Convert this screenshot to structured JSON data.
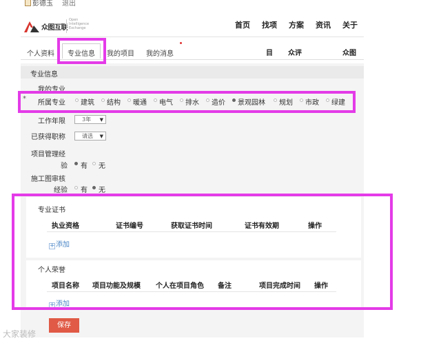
{
  "topbar": {
    "username": "彭德玉",
    "logout": "退出"
  },
  "header": {
    "logo_text": "众图互联",
    "logo_sub": "Open Intelligence Exchange",
    "nav": [
      "首页",
      "找项",
      "方案",
      "资讯",
      "关于"
    ]
  },
  "tabs": [
    {
      "label": "个人资料",
      "active": false
    },
    {
      "label": "专业信息",
      "active": true
    },
    {
      "label": "我的项目",
      "active": false
    },
    {
      "label": "我的消息",
      "active": false
    }
  ],
  "right_links": [
    "目",
    "众评",
    "众图"
  ],
  "form": {
    "title": "专业信息",
    "my_specialty_label": "我的专业",
    "specialty_label": "所属专业",
    "specialty_options": [
      {
        "label": "建筑",
        "checked": false
      },
      {
        "label": "结构",
        "checked": false
      },
      {
        "label": "暖通",
        "checked": false
      },
      {
        "label": "电气",
        "checked": false
      },
      {
        "label": "排水",
        "checked": false
      },
      {
        "label": "造价",
        "checked": false
      },
      {
        "label": "景观园林",
        "checked": true
      },
      {
        "label": "规划",
        "checked": false
      },
      {
        "label": "市政",
        "checked": false
      },
      {
        "label": "绿建",
        "checked": false
      }
    ],
    "years_label": "工作年限",
    "years_value": "3年",
    "title_obtained_label": "已获得职称",
    "title_obtained_value": "请选",
    "pm_exp_label1": "项目管理经",
    "pm_exp_label2": "验",
    "review_exp_label1": "施工图审核",
    "review_exp_label2": "经验",
    "yes": "有",
    "no": "无"
  },
  "certificates": {
    "title": "专业证书",
    "columns": [
      "执业资格",
      "证书编号",
      "获取证书时间",
      "证书有效期",
      "操作"
    ],
    "add_label": "添加"
  },
  "honors": {
    "title": "个人荣誉",
    "columns": [
      "项目名称",
      "项目功能及规模",
      "个人在项目角色",
      "备注",
      "项目完成时间",
      "操作"
    ],
    "add_label": "添加"
  },
  "save_label": "保存",
  "watermark": "大家装修"
}
